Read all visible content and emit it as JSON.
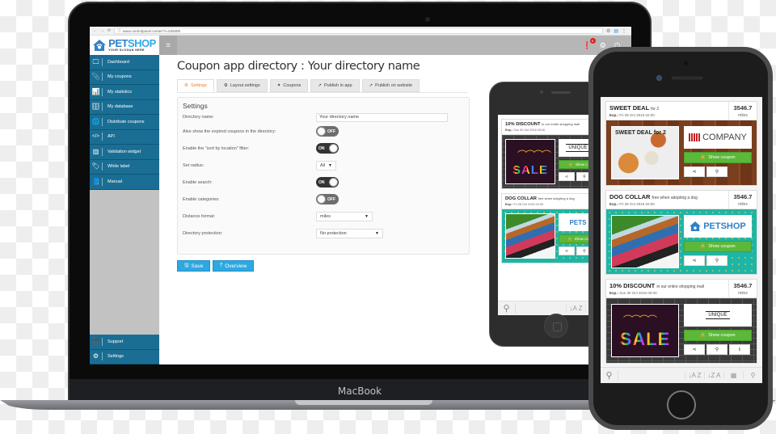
{
  "laptop": {
    "brand": "MacBook",
    "browser": {
      "url": "www.controlpanel.center/?i=539480",
      "back_icon": "←",
      "forward_icon": "→",
      "reload_icon": "⟳",
      "secure_icon": "ⓘ"
    },
    "app": {
      "logo": {
        "pet": "PET",
        "shop": "SHOP",
        "tagline": "YOUR SLOGAN HERE"
      },
      "sidebar": {
        "items": [
          {
            "label": "Dashboard",
            "icon": "🖵"
          },
          {
            "label": "My coupons",
            "icon": "📎"
          },
          {
            "label": "My statistics",
            "icon": "📊"
          },
          {
            "label": "My database",
            "icon": "🗄"
          },
          {
            "label": "Distribute coupons",
            "icon": "🌐"
          },
          {
            "label": "API",
            "icon": "</>"
          },
          {
            "label": "Validation widget",
            "icon": "▥"
          },
          {
            "label": "White label",
            "icon": "🏷"
          },
          {
            "label": "Manual",
            "icon": "📘"
          }
        ],
        "bottom_items": [
          {
            "label": "Support",
            "icon": "🎧"
          },
          {
            "label": "Settings",
            "icon": "⚙"
          }
        ]
      },
      "topbar": {
        "notification_count": "6"
      },
      "page_title": "Coupon app directory : Your directory name",
      "tabs": [
        {
          "label": "Settings",
          "icon": "⚙",
          "active": true
        },
        {
          "label": "Layout settings",
          "icon": "⚙",
          "active": false
        },
        {
          "label": "Coupons",
          "icon": "✦",
          "active": false
        },
        {
          "label": "Publish in app",
          "icon": "➚",
          "active": false
        },
        {
          "label": "Publish on website",
          "icon": "➚",
          "active": false
        }
      ],
      "settings": {
        "title": "Settings",
        "directory_name": {
          "label": "Directory name:",
          "value": "Your directory name"
        },
        "show_expired": {
          "label": "Also show the expired coupons in the directory:",
          "state": "OFF"
        },
        "sort_by_location": {
          "label": "Enable the \"sort by location\" filter:",
          "state": "ON"
        },
        "radius": {
          "label": "Set radius:",
          "value": "All"
        },
        "search": {
          "label": "Enable search:",
          "state": "ON"
        },
        "categories": {
          "label": "Enable categories:",
          "state": "OFF"
        },
        "distance_format": {
          "label": "Distance format:",
          "value": "miles"
        },
        "protection": {
          "label": "Directory protection:",
          "value": "No protection"
        }
      },
      "buttons": {
        "save": "Save",
        "overview": "Overview"
      }
    }
  },
  "phone": {
    "coupons": [
      {
        "title": "SWEET DEAL",
        "subtitle": "for 2",
        "exp_label": "Exp.:",
        "exp": "Fri 28 Oct 2016 02:00",
        "distance": "3546.7",
        "unit": "miles",
        "brand": "COMPANY",
        "image_label": "SWEET DEAL for 2",
        "show_label": "Show coupon"
      },
      {
        "title": "DOG COLLAR",
        "subtitle": "free when adopting a dog",
        "exp_label": "Exp.:",
        "exp": "Fri 28 Oct 2016 02:00",
        "distance": "3546.7",
        "unit": "miles",
        "brand": "PETSHOP",
        "show_label": "Show coupon"
      },
      {
        "title": "10% DISCOUNT",
        "subtitle": "in our entire shopping mall",
        "exp_label": "Exp.:",
        "exp": "Sun 30 Oct 2016 00:00",
        "distance": "3546.7",
        "unit": "miles",
        "brand": "UNIQUE",
        "image_label": "SALE",
        "show_label": "Show coupon"
      }
    ]
  },
  "tablet": {
    "coupons": [
      {
        "title": "10% DISCOUNT",
        "subtitle": "in our entire shopping mall",
        "exp_label": "Exp.:",
        "exp": "Sun 30 Oct 2016 00:00",
        "brand": "UNIQUE",
        "image_label": "SALE",
        "show_label": "Show c"
      },
      {
        "title": "DOG COLLAR",
        "subtitle": "free when adopting a dog",
        "exp_label": "Exp.:",
        "exp": "Fri 28 Oct 2016 02:00",
        "brand": "PETS",
        "show_label": "Show co"
      }
    ]
  },
  "toolbar_icons": {
    "search": "⚲",
    "sort_az": "↓A Z",
    "sort_za": "↓Z A",
    "calendar": "▦",
    "location": "⚲"
  },
  "card_icons": {
    "share": "⋖",
    "pin": "⚲",
    "info": "i",
    "lock": "🔒"
  }
}
